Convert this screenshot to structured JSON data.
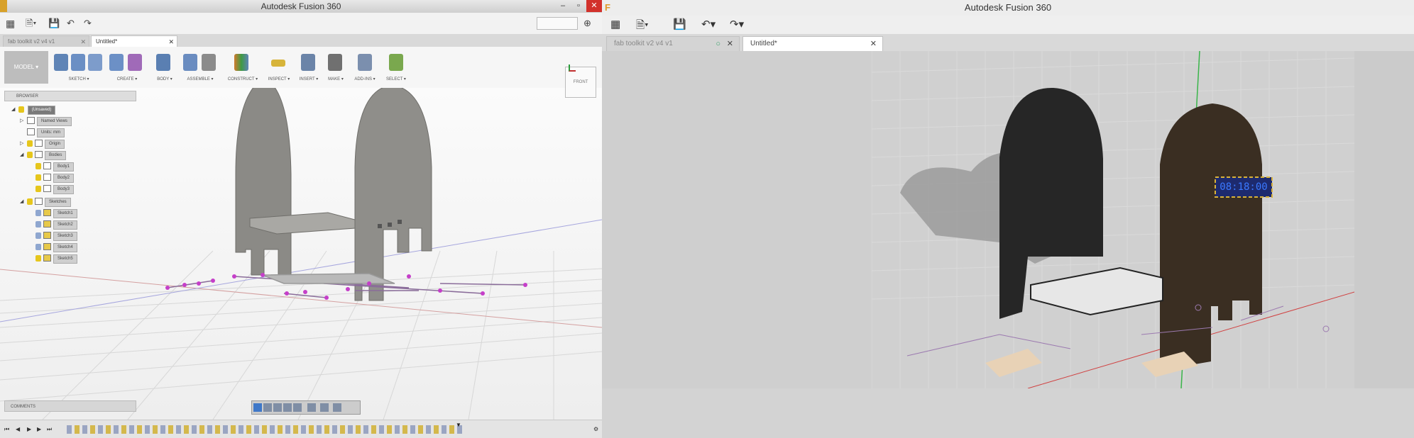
{
  "left_window": {
    "title": "Autodesk Fusion 360",
    "quick_access": {
      "undo": "↶",
      "redo": "↷"
    },
    "tabs": [
      {
        "label": "fab toolkit v2 v4 v1"
      },
      {
        "label": "Untitled*"
      }
    ],
    "ribbon": {
      "mode": "MODEL ▾",
      "groups": [
        "SKETCH ▾",
        "CREATE ▾",
        "BODY ▾",
        "ASSEMBLE ▾",
        "CONSTRUCT ▾",
        "INSPECT ▾",
        "INSERT ▾",
        "MAKE ▾",
        "ADD-INS ▾",
        "SELECT ▾"
      ]
    },
    "view_cube": {
      "face": "FRONT"
    },
    "browser": {
      "header": "BROWSER",
      "root": "(Unsaved)",
      "nodes": [
        "Named Views",
        "Units: mm",
        "Origin",
        "Bodies",
        "Body1",
        "Body2",
        "Body3",
        "Sketches",
        "Sketch1",
        "Sketch2",
        "Sketch3",
        "Sketch4",
        "Sketch5"
      ]
    },
    "comments": "COMMENTS",
    "timeline_controls": [
      "⏮",
      "◀",
      "▶",
      "▶",
      "⏭"
    ]
  },
  "right_window": {
    "title": "Autodesk Fusion 360",
    "tabs": [
      {
        "label": "fab toolkit v2 v4 v1"
      },
      {
        "label": "Untitled*"
      }
    ],
    "clock_display": "08:18:00"
  }
}
